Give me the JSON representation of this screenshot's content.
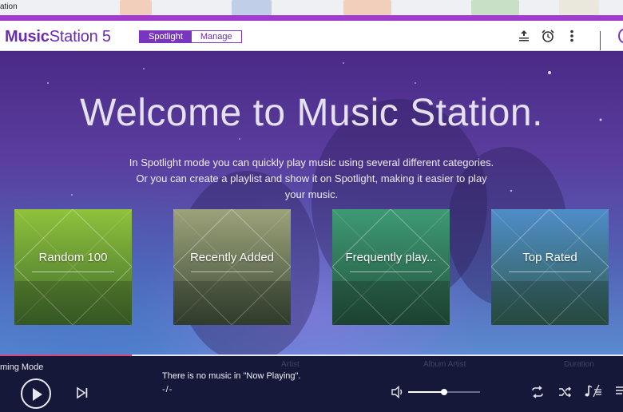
{
  "background_window": {
    "partial_title": "ation"
  },
  "header": {
    "logo_strong": "Music",
    "logo_rest": "Station 5",
    "tabs": [
      {
        "label": "Spotlight",
        "active": true
      },
      {
        "label": "Manage",
        "active": false
      }
    ],
    "icons": [
      "upload-queue-icon",
      "alarm-clock-icon",
      "more-vertical-icon"
    ]
  },
  "hero": {
    "title": "Welcome to Music Station.",
    "intro": "In Spotlight mode you can quickly play music using several different categories. Or you can create a playlist and show it on Spotlight, making it easier to play your music.",
    "tiles": [
      {
        "label": "Random 100",
        "color_top": "#8fc23c",
        "color_bottom": "#3f6a2c"
      },
      {
        "label": "Recently Added",
        "color_top": "#9ca27a",
        "color_bottom": "#3b4a36"
      },
      {
        "label": "Frequently play...",
        "color_top": "#3e9a74",
        "color_bottom": "#23513d"
      },
      {
        "label": "Top Rated",
        "color_top": "#4f8dc9",
        "color_bottom": "#2f5a4a"
      }
    ]
  },
  "player": {
    "mode_label": "ming Mode",
    "now_playing": "There is no music in \"Now Playing\".",
    "time": "-/-",
    "volume": 0.5,
    "ghost_labels": [
      "Artist",
      "Album Artist",
      "Duration"
    ],
    "icons": [
      "play-icon",
      "skip-next-icon",
      "volume-icon",
      "repeat-icon",
      "shuffle-icon",
      "lyrics-icon",
      "playlist-icon"
    ]
  },
  "colors": {
    "brand": "#6a2bb0",
    "accent": "#7a35c0",
    "topbar": "#a23bd0",
    "player_bg": "#16183a"
  }
}
